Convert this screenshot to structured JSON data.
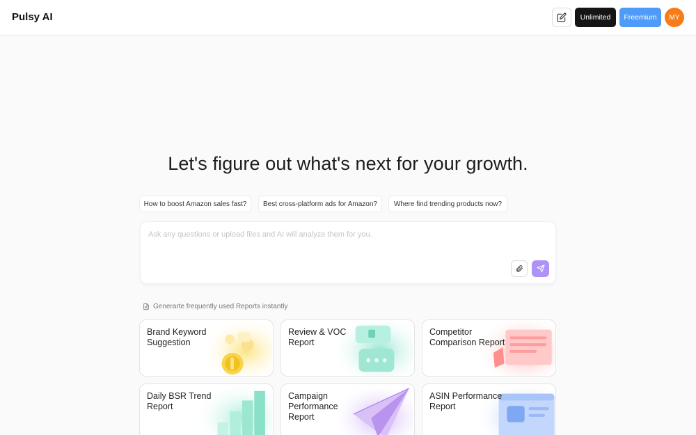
{
  "app": {
    "title": "Pulsy AI"
  },
  "header": {
    "plans": {
      "unlimited": "Unlimited",
      "freemium": "Freemium"
    },
    "avatar_initials": "MY"
  },
  "hero": {
    "headline": "Let's figure out what's next for your growth."
  },
  "suggestions": [
    "How to boost Amazon sales fast?",
    "Best cross-platform ads for Amazon?",
    "Where find trending products now?"
  ],
  "chat": {
    "placeholder": "Ask any questions or upload files and AI will analyze them for you.",
    "value": ""
  },
  "reports": {
    "hint": "Generarte frequently used Reports instantly",
    "cards": [
      {
        "title": "Brand Keyword Suggestion",
        "accent": "#fde27a"
      },
      {
        "title": "Review & VOC Report",
        "accent": "#8fe3cf"
      },
      {
        "title": "Competitor Comparison Report",
        "accent": "#ff9f9f"
      },
      {
        "title": "Daily BSR Trend Report",
        "accent": "#a6ecd8"
      },
      {
        "title": "Campaign Performance Report",
        "accent": "#cba9f5"
      },
      {
        "title": "ASIN Performance Report",
        "accent": "#93b7f7"
      }
    ]
  },
  "colors": {
    "brand_accent": "#ac93f5",
    "freemium": "#4f9bf7",
    "unlimited": "#151515",
    "avatar": "#f57c17"
  }
}
